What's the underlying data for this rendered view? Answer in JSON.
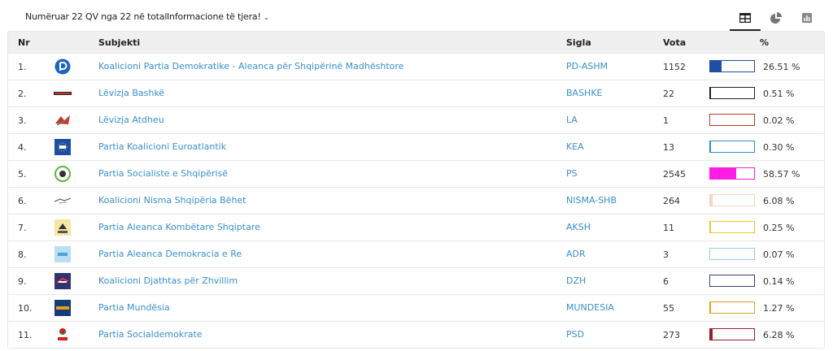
{
  "header": {
    "counted": "Numëruar 22 QV nga 22 në total",
    "info_label": "Informacione të tjera!",
    "tabs": [
      "table-view",
      "pie-view",
      "bar-view"
    ]
  },
  "table": {
    "columns": {
      "nr": "Nr",
      "subject": "Subjekti",
      "sigla": "Sigla",
      "vota": "Vota",
      "pct": "%"
    },
    "rows": [
      {
        "nr": "1.",
        "name": "Koalicioni Partia Demokratike - Aleanca për Shqipërinë Madhështore",
        "sigla": "PD-ASHM",
        "votes": "1152",
        "pct": "26.51 %",
        "share": 0.2651,
        "color": "#1f4ea3",
        "logo": "pd-logo"
      },
      {
        "nr": "2.",
        "name": "Lëvizja Bashkë",
        "sigla": "BASHKE",
        "votes": "22",
        "pct": "0.51 %",
        "share": 0.0051,
        "color": "#222222",
        "logo": "bashke-logo"
      },
      {
        "nr": "3.",
        "name": "Lëvizja Atdheu",
        "sigla": "LA",
        "votes": "1",
        "pct": "0.02 %",
        "share": 0.0002,
        "color": "#c0392b",
        "logo": "la-logo"
      },
      {
        "nr": "4.",
        "name": "Partia Koalicioni Euroatlantik",
        "sigla": "KEA",
        "votes": "13",
        "pct": "0.30 %",
        "share": 0.003,
        "color": "#2b8fd6",
        "logo": "kea-logo"
      },
      {
        "nr": "5.",
        "name": "Partia Socialiste e Shqipërisë",
        "sigla": "PS",
        "votes": "2545",
        "pct": "58.57 %",
        "share": 0.5857,
        "color": "#ff1de5",
        "logo": "ps-logo"
      },
      {
        "nr": "6.",
        "name": "Koalicioni Nisma Shqipëria Bëhet",
        "sigla": "NISMA-SHB",
        "votes": "264",
        "pct": "6.08 %",
        "share": 0.0608,
        "color": "#f5d5c0",
        "logo": "nisma-logo"
      },
      {
        "nr": "7.",
        "name": "Partia Aleanca Kombëtare Shqiptare",
        "sigla": "AKSH",
        "votes": "11",
        "pct": "0.25 %",
        "share": 0.0025,
        "color": "#e8c830",
        "logo": "aksh-logo"
      },
      {
        "nr": "8.",
        "name": "Partia Aleanca Demokracia e Re",
        "sigla": "ADR",
        "votes": "3",
        "pct": "0.07 %",
        "share": 0.0007,
        "color": "#8ecfe8",
        "logo": "adr-logo"
      },
      {
        "nr": "9.",
        "name": "Koalicioni Djathtas për Zhvillim",
        "sigla": "DZH",
        "votes": "6",
        "pct": "0.14 %",
        "share": 0.0014,
        "color": "#3b3f73",
        "logo": "dzh-logo"
      },
      {
        "nr": "10.",
        "name": "Partia Mundësia",
        "sigla": "MUNDESIA",
        "votes": "55",
        "pct": "1.27 %",
        "share": 0.0127,
        "color": "#e0a020",
        "logo": "mundesia-logo"
      },
      {
        "nr": "11.",
        "name": "Partia Socialdemokrate",
        "sigla": "PSD",
        "votes": "273",
        "pct": "6.28 %",
        "share": 0.0628,
        "color": "#9b1c2a",
        "logo": "psd-logo"
      }
    ]
  }
}
